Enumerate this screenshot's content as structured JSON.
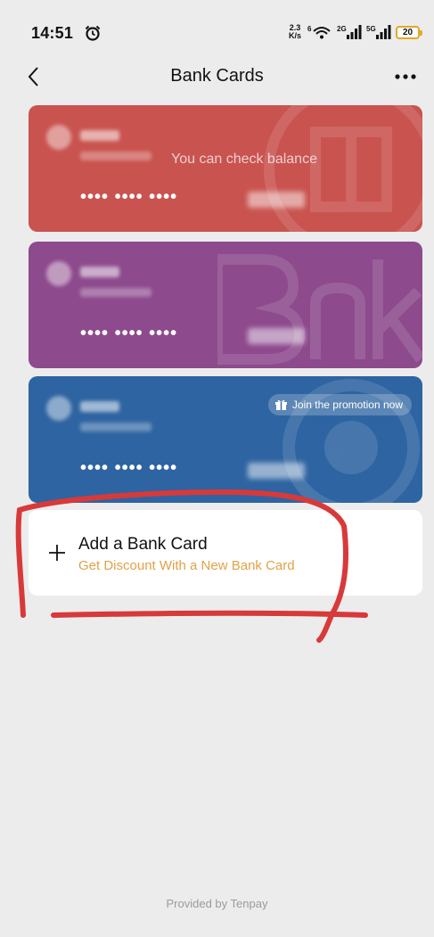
{
  "status_bar": {
    "time": "14:51",
    "net_speed_value": "2.3",
    "net_speed_unit": "K/s",
    "network_labels": [
      "6",
      "2G",
      "5G"
    ],
    "battery": "20"
  },
  "nav": {
    "title": "Bank Cards",
    "back_icon": "chevron-left-icon",
    "more_icon": "ellipsis-icon"
  },
  "cards": [
    {
      "color": "#c9534f",
      "status_text": "You can check balance",
      "masked_number": "•••• •••• ••••"
    },
    {
      "color": "#8d4a8d",
      "status_text": "",
      "masked_number": "•••• •••• ••••"
    },
    {
      "color": "#2e64a1",
      "promo_text": "Join the promotion now",
      "masked_number": "•••• •••• ••••"
    }
  ],
  "add_card": {
    "title": "Add a Bank Card",
    "subtitle": "Get Discount With a New Bank Card",
    "accent_color": "#e0a247"
  },
  "footer": {
    "text": "Provided by Tenpay"
  },
  "annotation_color": "#d8393a"
}
